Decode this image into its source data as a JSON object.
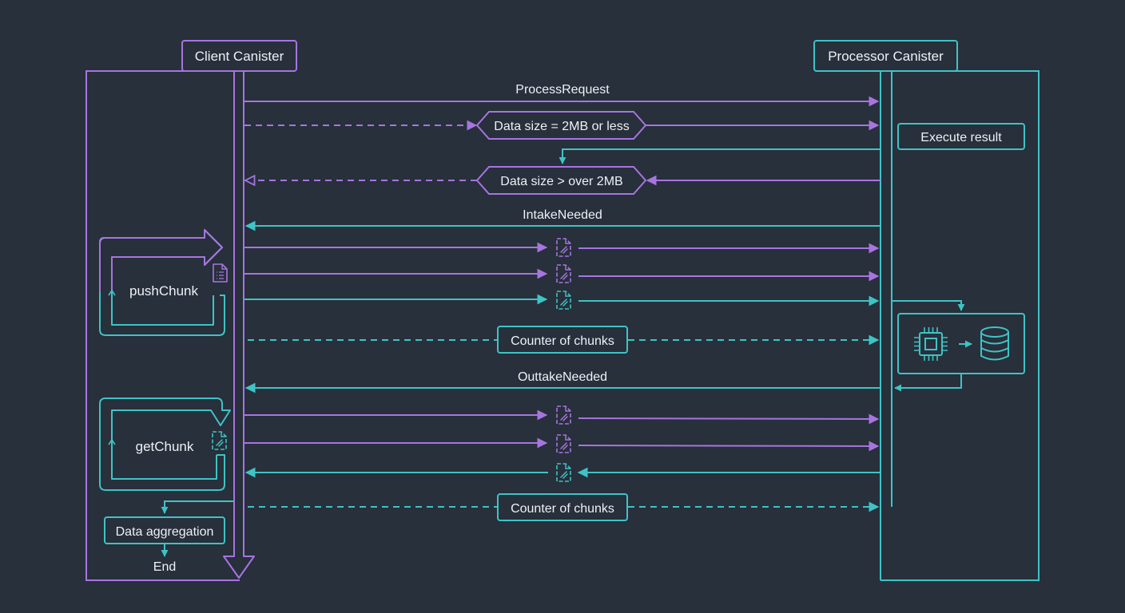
{
  "colors": {
    "background": "#27303b",
    "client": "#a874e0",
    "processor": "#3fc3c6",
    "text": "#eef1f6"
  },
  "participants": {
    "client": "Client Canister",
    "processor": "Processor Canister"
  },
  "messages": {
    "process_request": "ProcessRequest",
    "data_small": "Data size = 2MB or less",
    "execute_result": "Execute result",
    "data_large": "Data size > over 2MB",
    "intake_needed": "IntakeNeeded",
    "push_chunk": "pushChunk",
    "counter_intake": "Counter of chunks",
    "outtake_needed": "OuttakeNeeded",
    "get_chunk": "getChunk",
    "counter_outtake": "Counter of chunks",
    "data_aggregation": "Data aggregation",
    "end": "End"
  },
  "icons": {
    "chunk": "file-chunk-icon",
    "list": "file-list-icon",
    "cpu": "cpu-chip-icon",
    "database": "database-icon"
  }
}
